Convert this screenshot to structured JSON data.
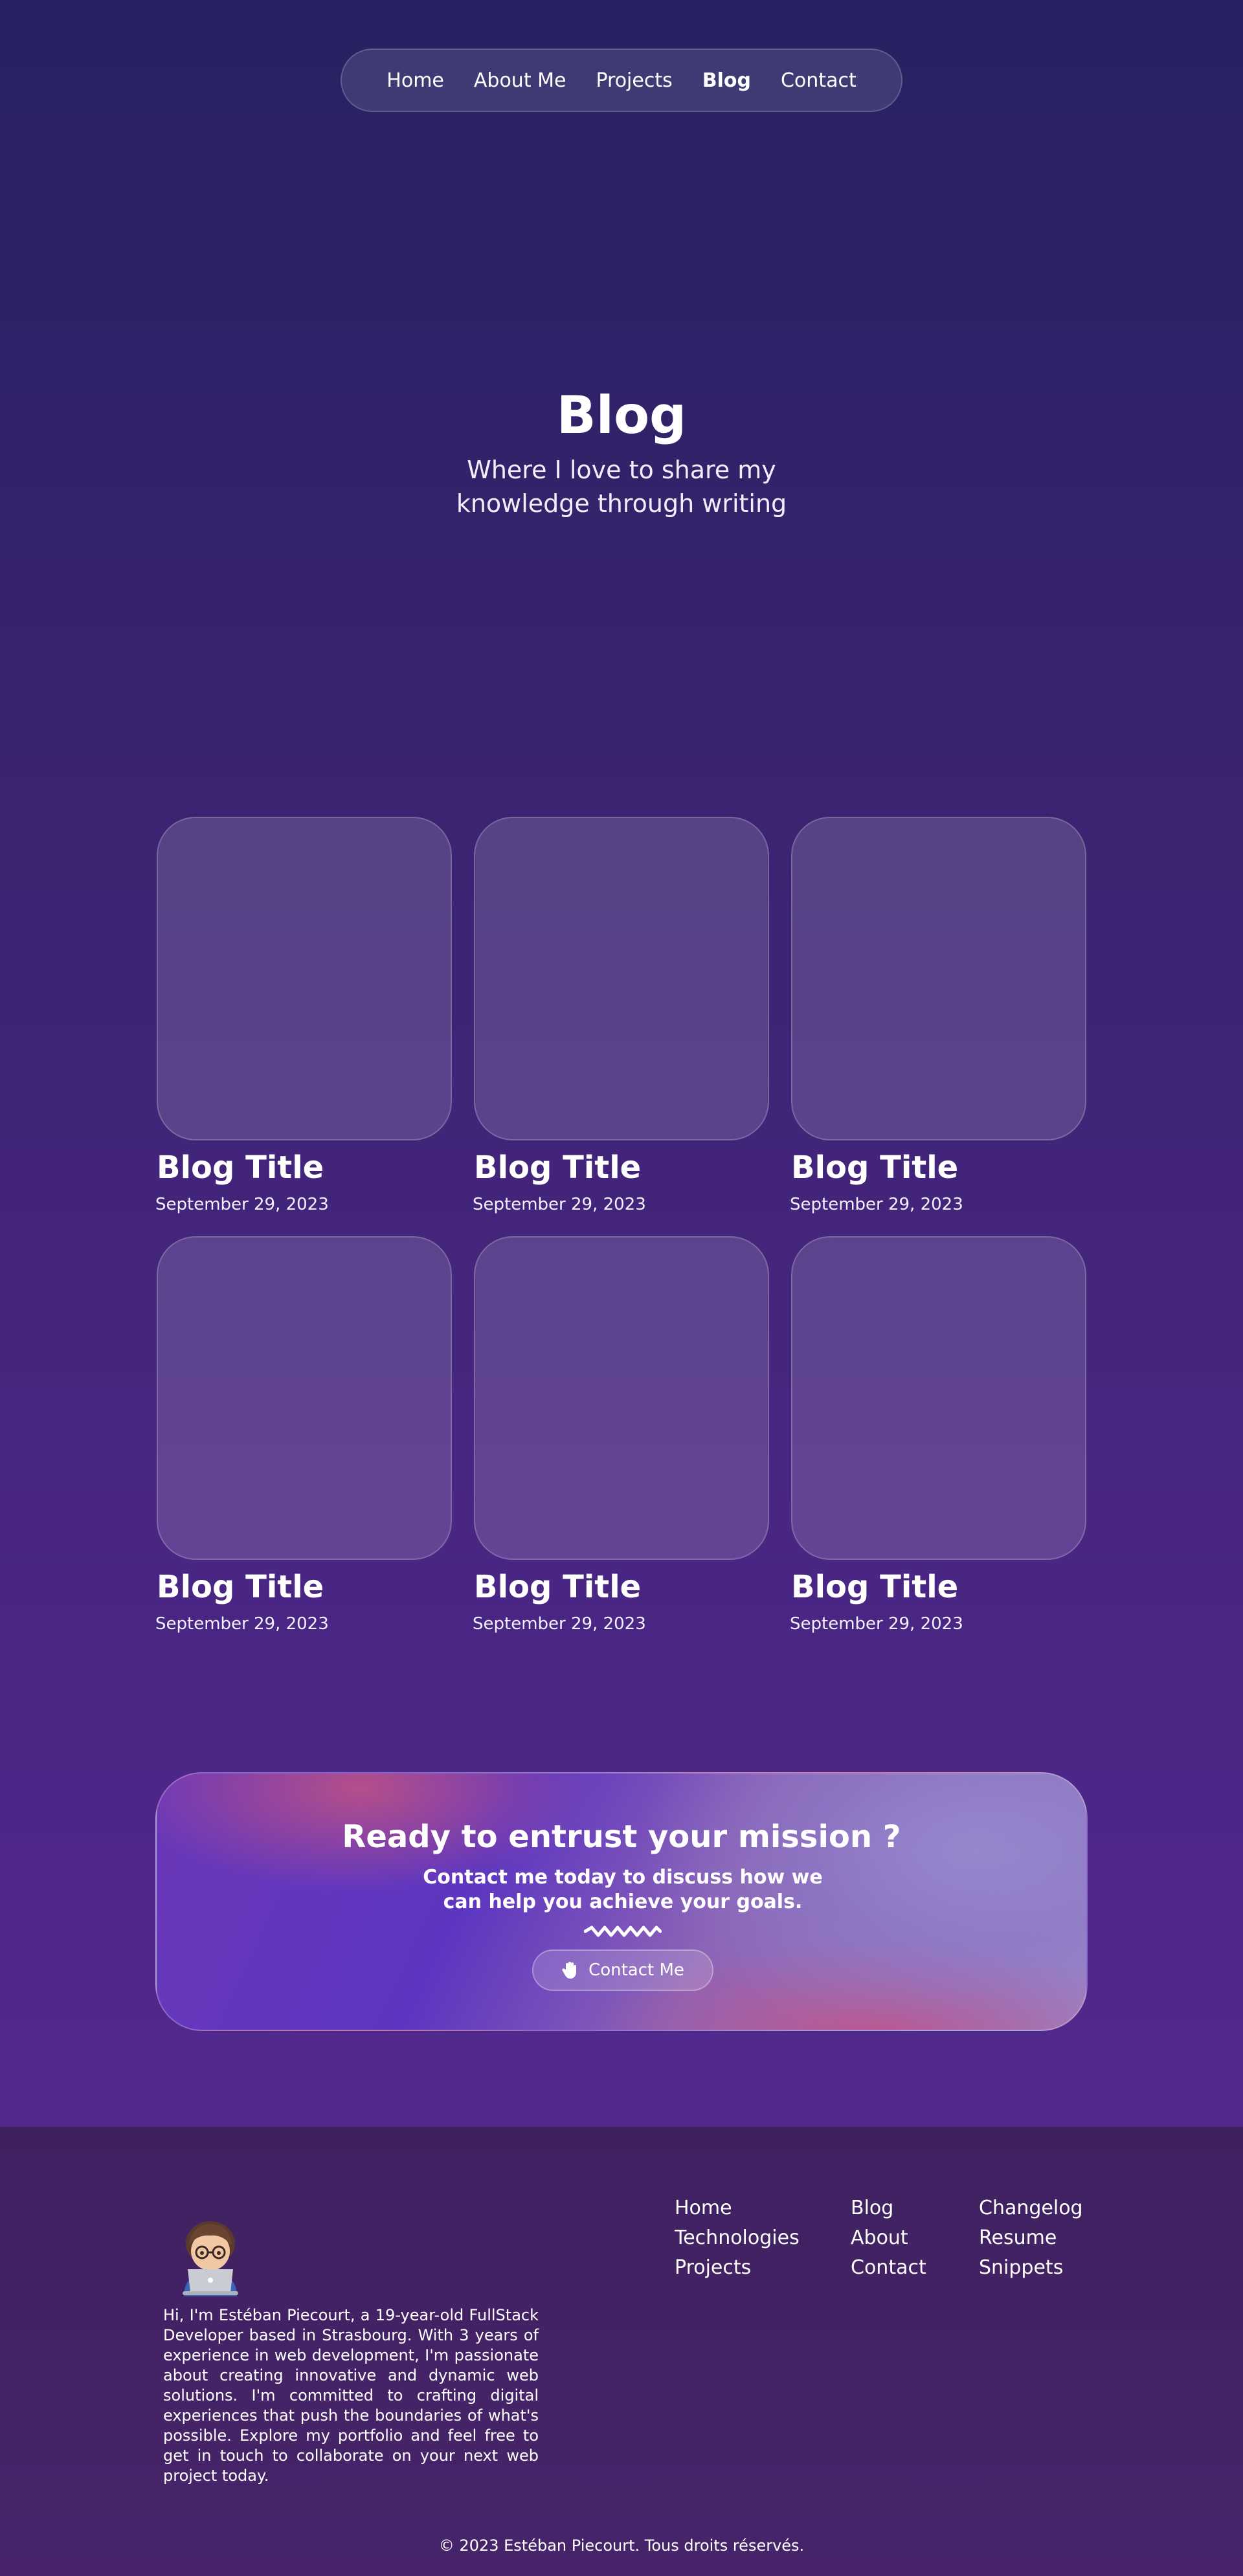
{
  "nav": {
    "items": [
      "Home",
      "About Me",
      "Projects",
      "Blog",
      "Contact"
    ],
    "active": "Blog"
  },
  "hero": {
    "title": "Blog",
    "subtitle": "Where I love to share my knowledge through writing"
  },
  "posts": [
    {
      "title": "Blog Title",
      "date": "September 29, 2023"
    },
    {
      "title": "Blog Title",
      "date": "September 29, 2023"
    },
    {
      "title": "Blog Title",
      "date": "September 29, 2023"
    },
    {
      "title": "Blog Title",
      "date": "September 29, 2023"
    },
    {
      "title": "Blog Title",
      "date": "September 29, 2023"
    },
    {
      "title": "Blog Title",
      "date": "September 29, 2023"
    }
  ],
  "cta": {
    "title": "Ready to entrust your mission ?",
    "subtitle": "Contact me today to discuss how we can help you achieve your goals.",
    "button_label": "Contact Me",
    "button_icon": "waving-hand-icon"
  },
  "footer": {
    "bio": "Hi, I'm Estéban Piecourt, a 19-year-old FullStack Developer based in Strasbourg. With 3 years of experience in web development, I'm passionate about creating innovative and dynamic web solutions. I'm committed to crafting digital experiences that push the boundaries of what's possible. Explore my portfolio and feel free to get in touch to collaborate on your next web project today.",
    "columns": [
      [
        "Home",
        "Technologies",
        "Projects"
      ],
      [
        "Blog",
        "About",
        "Contact"
      ],
      [
        "Changelog",
        "Resume",
        "Snippets"
      ]
    ],
    "copyright": "© 2023 Estéban Piecourt. Tous droits réservés."
  },
  "colors": {
    "background_top": "#272262",
    "background_bottom": "#542a8e",
    "footer": "#42215f",
    "cta_pink": "#b9508a",
    "cta_violet": "#5c36c0"
  }
}
